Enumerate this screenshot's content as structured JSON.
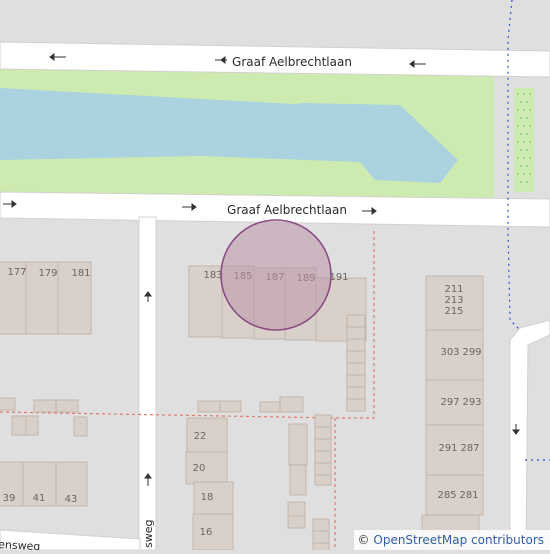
{
  "map": {
    "streets": {
      "north": "Graaf Aelbrechtlaan",
      "south": "Graaf Aelbrechtlaan",
      "bottom_left": "ensweg",
      "vertical_left": "sweg"
    },
    "house_numbers": {
      "n177": "177",
      "n179": "179",
      "n181": "181",
      "n183": "183",
      "n185": "185",
      "n187": "187",
      "n189": "189",
      "n191": "191",
      "n211": "211",
      "n213": "213",
      "n215": "215",
      "n303": "303",
      "n299": "299",
      "n297": "297",
      "n293": "293",
      "n291": "291",
      "n287": "287",
      "n285": "285",
      "n281": "281",
      "n22": "22",
      "n20": "20",
      "n18": "18",
      "n16": "16",
      "n39": "39",
      "n41": "41",
      "n43": "43"
    },
    "colors": {
      "background": "#e0dfdf",
      "road": "#ffffff",
      "water": "#aad3df",
      "grass": "#cdebb0",
      "building": "#d9d0c9",
      "building_outline": "#c4b6ab",
      "marker_fill": "#b993a9",
      "marker_stroke": "#8a4d84",
      "boundary_red": "#e07a6a",
      "boundary_blue": "#2c4fd8"
    }
  },
  "attribution": {
    "symbol": "©",
    "text": "OpenStreetMap contributors"
  }
}
